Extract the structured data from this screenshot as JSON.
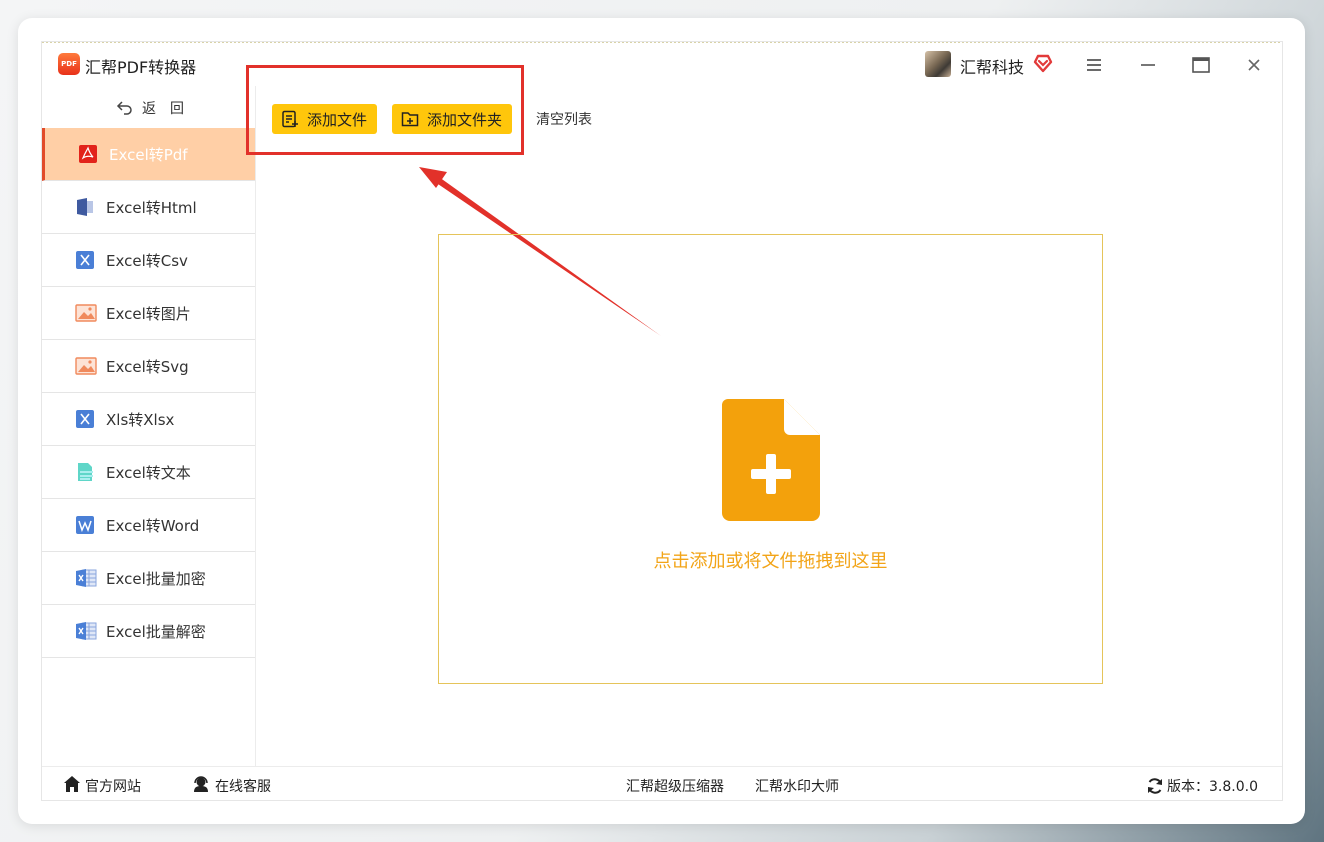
{
  "app": {
    "logo_text": "PDF",
    "title": "汇帮PDF转换器"
  },
  "user": {
    "name": "汇帮科技"
  },
  "sidebar": {
    "back_label": "返回",
    "items": [
      {
        "label": "Excel转Pdf",
        "icon": "pdf-icon",
        "active": true
      },
      {
        "label": "Excel转Html",
        "icon": "html-icon"
      },
      {
        "label": "Excel转Csv",
        "icon": "excel-icon"
      },
      {
        "label": "Excel转图片",
        "icon": "image-icon"
      },
      {
        "label": "Excel转Svg",
        "icon": "image-icon"
      },
      {
        "label": "Xls转Xlsx",
        "icon": "excel-icon"
      },
      {
        "label": "Excel转文本",
        "icon": "text-doc-icon"
      },
      {
        "label": "Excel转Word",
        "icon": "word-icon"
      },
      {
        "label": "Excel批量加密",
        "icon": "excel-sheet-icon"
      },
      {
        "label": "Excel批量解密",
        "icon": "excel-sheet-icon"
      }
    ]
  },
  "toolbar": {
    "add_file": "添加文件",
    "add_folder": "添加文件夹",
    "clear_list": "清空列表"
  },
  "dropzone": {
    "text": "点击添加或将文件拖拽到这里",
    "icon": "file-add-icon"
  },
  "footer": {
    "official_site": "官方网站",
    "online_service": "在线客服",
    "compressor": "汇帮超级压缩器",
    "watermark": "汇帮水印大师",
    "version": "版本：3.8.0.0"
  },
  "colors": {
    "accent_yellow": "#ffc60b",
    "active_bg": "#ffcfa6",
    "highlight_red": "#e2312a",
    "drop_text": "#f2a418",
    "file_icon": "#f3a10c"
  }
}
